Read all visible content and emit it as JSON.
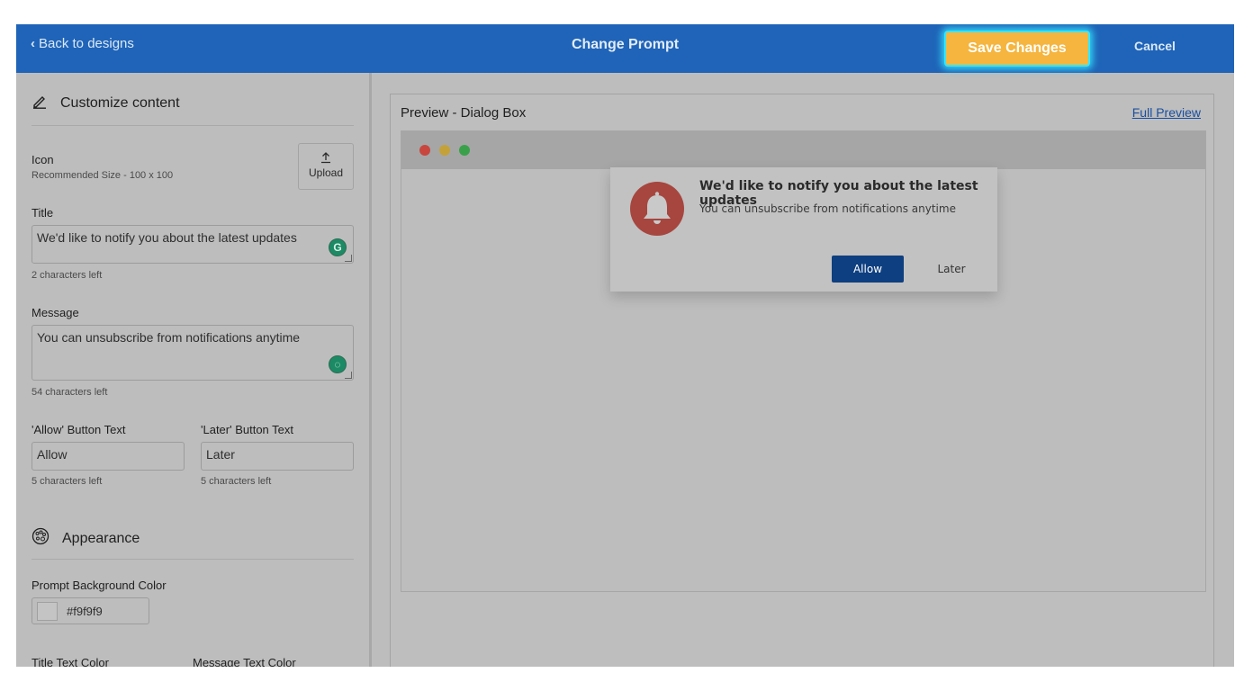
{
  "header": {
    "back_label": "Back to designs",
    "title": "Change Prompt",
    "save_label": "Save Changes",
    "cancel_label": "Cancel"
  },
  "customize": {
    "heading": "Customize content",
    "icon_label": "Icon",
    "icon_hint": "Recommended Size - 100 x 100",
    "upload_label": "Upload",
    "title_label": "Title",
    "title_value": "We'd like to notify you about the latest updates",
    "title_remaining": "2 characters left",
    "message_label": "Message",
    "message_value": "You can unsubscribe from notifications anytime",
    "message_remaining": "54 characters left",
    "allow_label": "'Allow' Button Text",
    "allow_value": "Allow",
    "allow_remaining": "5 characters left",
    "later_label": "'Later' Button Text",
    "later_value": "Later",
    "later_remaining": "5 characters left"
  },
  "appearance": {
    "heading": "Appearance",
    "bg_color_label": "Prompt Background Color",
    "bg_color_value": "#f9f9f9",
    "title_color_label": "Title Text Color",
    "message_color_label": "Message Text Color"
  },
  "preview": {
    "title": "Preview - Dialog Box",
    "full_preview_label": "Full Preview",
    "dialog_title": "We'd like to notify you about the latest updates",
    "dialog_message": "You can unsubscribe from notifications anytime",
    "allow_button": "Allow",
    "later_button": "Later"
  },
  "colors": {
    "header": "#1f64b8",
    "save_button": "#f5b53e",
    "save_glow": "#36e6ff",
    "allow_button": "#0e3f80",
    "bell": "#a6463f",
    "dot_red": "#c9463f",
    "dot_yellow": "#c4a239",
    "dot_green": "#3aa14a"
  },
  "icons": [
    "chevron-left-icon",
    "pencil-icon",
    "upload-icon",
    "grammarly-icon",
    "palette-icon",
    "bell-icon"
  ]
}
